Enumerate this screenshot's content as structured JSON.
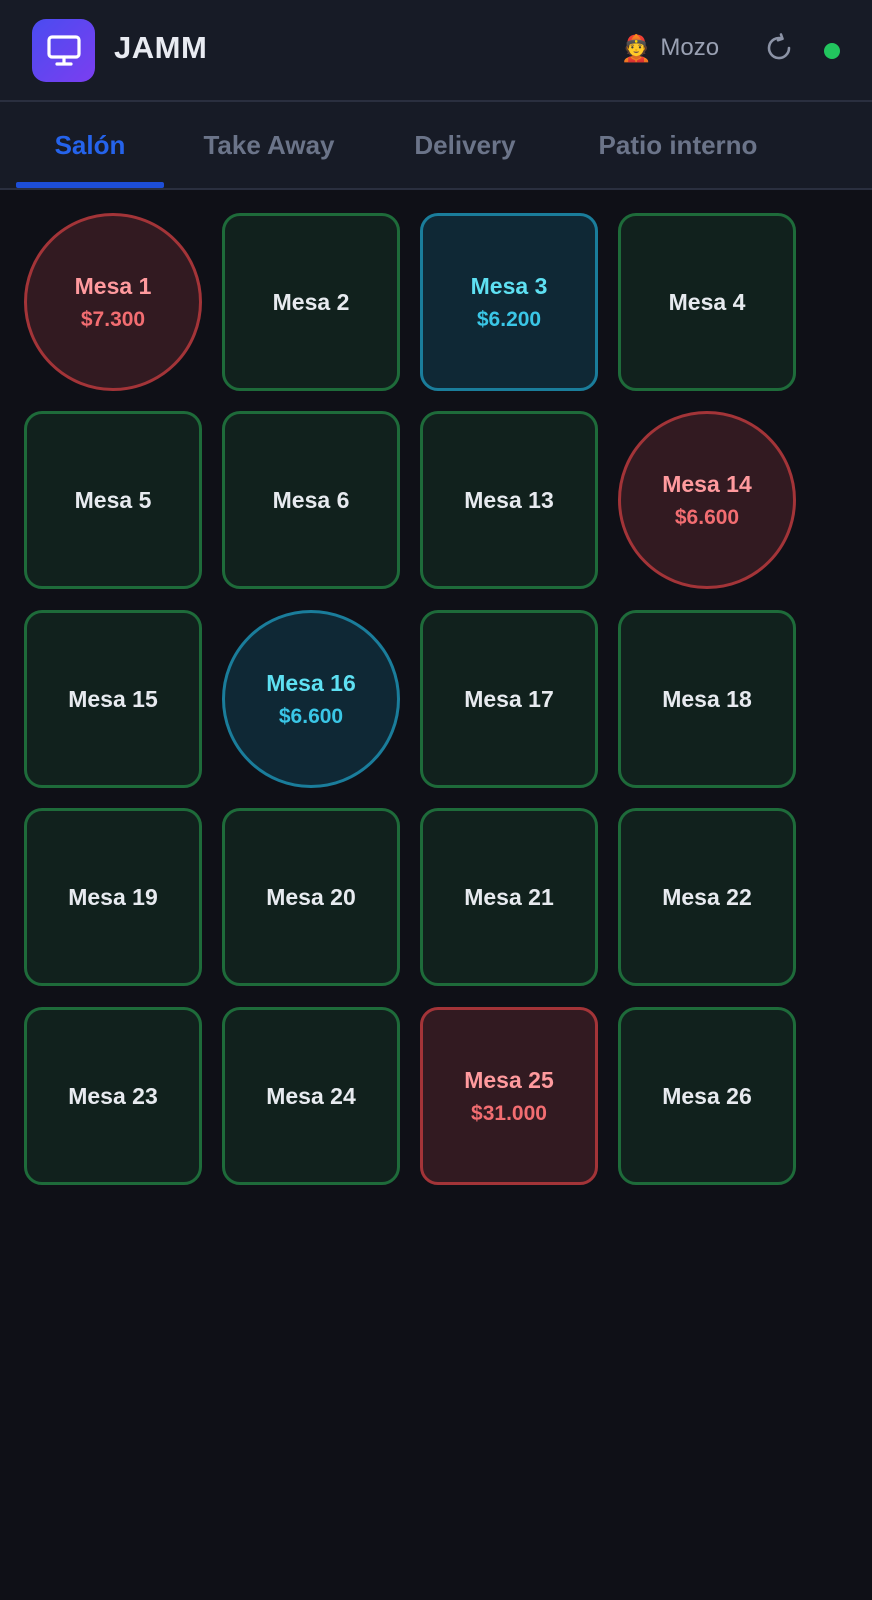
{
  "header": {
    "app_name": "JAMM",
    "role_icon": "waiter-emoji",
    "role_label": "Mozo",
    "connection_status_color": "#22c55e"
  },
  "tabs": [
    {
      "label": "Salón",
      "active": true
    },
    {
      "label": "Take Away",
      "active": false
    },
    {
      "label": "Delivery",
      "active": false
    },
    {
      "label": "Patio interno",
      "active": false
    }
  ],
  "status_colors": {
    "free_border": "#1e6b3a",
    "occupied_border": "#a33438",
    "billing_border": "#1a7d9b"
  },
  "tables": [
    {
      "name": "Mesa 1",
      "amount": "$7.300",
      "status": "occupied",
      "shape": "round"
    },
    {
      "name": "Mesa 2",
      "amount": "",
      "status": "free",
      "shape": "square"
    },
    {
      "name": "Mesa 3",
      "amount": "$6.200",
      "status": "billing",
      "shape": "square"
    },
    {
      "name": "Mesa 4",
      "amount": "",
      "status": "free",
      "shape": "square"
    },
    {
      "name": "Mesa 5",
      "amount": "",
      "status": "free",
      "shape": "square"
    },
    {
      "name": "Mesa 6",
      "amount": "",
      "status": "free",
      "shape": "square"
    },
    {
      "name": "Mesa 13",
      "amount": "",
      "status": "free",
      "shape": "square"
    },
    {
      "name": "Mesa 14",
      "amount": "$6.600",
      "status": "occupied",
      "shape": "round"
    },
    {
      "name": "Mesa 15",
      "amount": "",
      "status": "free",
      "shape": "square"
    },
    {
      "name": "Mesa 16",
      "amount": "$6.600",
      "status": "billing",
      "shape": "round"
    },
    {
      "name": "Mesa 17",
      "amount": "",
      "status": "free",
      "shape": "square"
    },
    {
      "name": "Mesa 18",
      "amount": "",
      "status": "free",
      "shape": "square"
    },
    {
      "name": "Mesa 19",
      "amount": "",
      "status": "free",
      "shape": "square"
    },
    {
      "name": "Mesa 20",
      "amount": "",
      "status": "free",
      "shape": "square"
    },
    {
      "name": "Mesa 21",
      "amount": "",
      "status": "free",
      "shape": "square"
    },
    {
      "name": "Mesa 22",
      "amount": "",
      "status": "free",
      "shape": "square"
    },
    {
      "name": "Mesa 23",
      "amount": "",
      "status": "free",
      "shape": "square"
    },
    {
      "name": "Mesa 24",
      "amount": "",
      "status": "free",
      "shape": "square"
    },
    {
      "name": "Mesa 25",
      "amount": "$31.000",
      "status": "occupied",
      "shape": "square"
    },
    {
      "name": "Mesa 26",
      "amount": "",
      "status": "free",
      "shape": "square"
    }
  ]
}
